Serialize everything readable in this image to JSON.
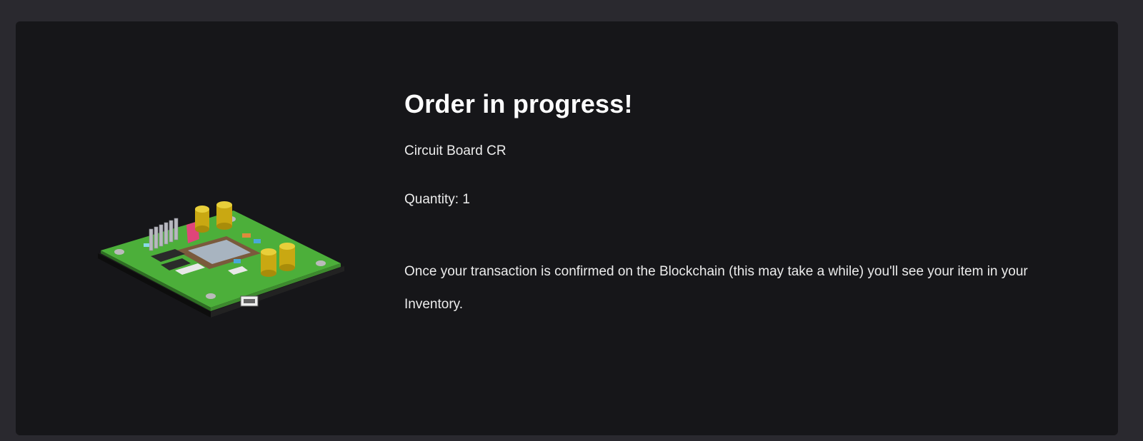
{
  "order": {
    "title": "Order in progress!",
    "item_name": "Circuit Board CR",
    "quantity_label": "Quantity:",
    "quantity_value": "1",
    "message": "Once your transaction is confirmed on the Blockchain (this may take a while) you'll see your item in your Inventory."
  },
  "image": {
    "icon": "circuit-board-image"
  },
  "colors": {
    "page_background": "#2a292f",
    "card_background": "#161619",
    "text": "#ffffff",
    "board_green": "#4caf3a"
  }
}
